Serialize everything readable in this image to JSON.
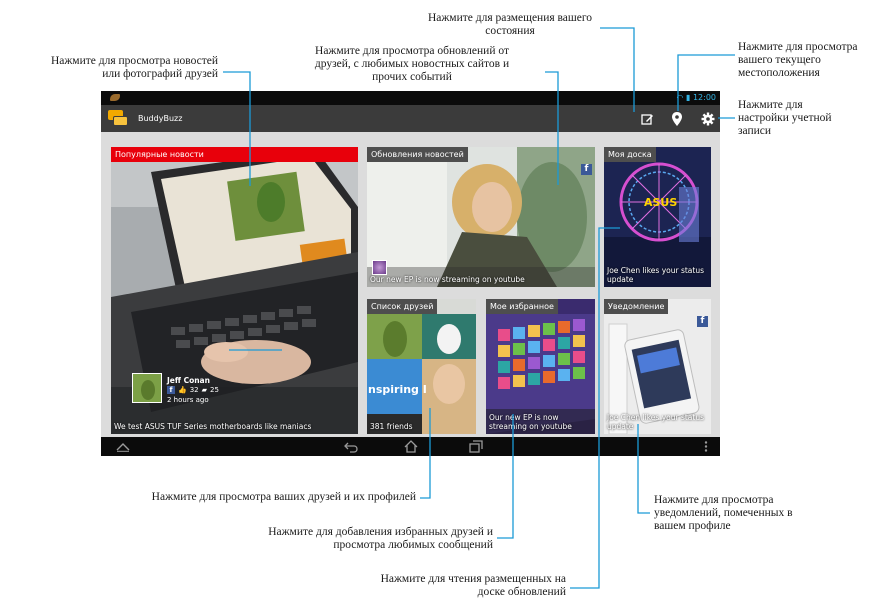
{
  "callouts": {
    "news_photos": "Нажмите для просмотра новостей\nили фотографий друзей",
    "news_updates": "Нажмите для просмотра обновлений от\nдрузей, с любимых новостных сайтов и\nпрочих событий",
    "post_status": "Нажмите для размещения вашего\nсостояния",
    "location": "Нажмите для просмотра\nвашего текущего\nместоположения",
    "account": "Нажмите для\nнастройки учетной\nзаписи",
    "friends": "Нажмите для просмотра ваших друзей и их профилей",
    "favorites": "Нажмите для добавления избранных друзей и\nпросмотра любимых сообщений",
    "wall": "Нажмите для чтения размещенных на\nдоске обновлений",
    "notifications": "Нажмите для просмотра\nуведомлений, помеченных в\nвашем профиле"
  },
  "status_bar": {
    "time": "12:00"
  },
  "app": {
    "title": "BuddyBuzz"
  },
  "tiles": {
    "popular": {
      "header": "Популярные новости",
      "caption": "We test ASUS TUF Series motherboards like maniacs",
      "author": "Jeff Conan",
      "likes": "32",
      "comments": "25",
      "time": "2 hours ago"
    },
    "updates": {
      "header": "Обновления новостей",
      "caption": "Our new EP is now streaming on youtube"
    },
    "wall": {
      "header": "Моя доска",
      "caption": "Joe Chen likes your status update",
      "sign_text": "ASUS"
    },
    "friends": {
      "header": "Список друзей",
      "caption": "381 friends",
      "sign_text": "nspiring I"
    },
    "favorites": {
      "header": "Мое избранное",
      "caption": "Our new EP is now streaming on youtube"
    },
    "notifications": {
      "header": "Уведомление",
      "caption": "Joe Chen likes your status update"
    }
  },
  "colors": {
    "accent_red": "#e8000b",
    "facebook_blue": "#3b5998",
    "holo_blue": "#33b5e5",
    "leader_line": "#1b9ad6"
  },
  "icons": {
    "status_bar": [
      "wifi-icon",
      "battery-icon"
    ],
    "action_bar": [
      "edit-status-icon",
      "location-pin-icon",
      "settings-gear-icon"
    ],
    "nav_bar": [
      "collapse-icon",
      "back-icon",
      "home-icon",
      "recent-apps-icon",
      "overflow-menu-icon"
    ]
  }
}
